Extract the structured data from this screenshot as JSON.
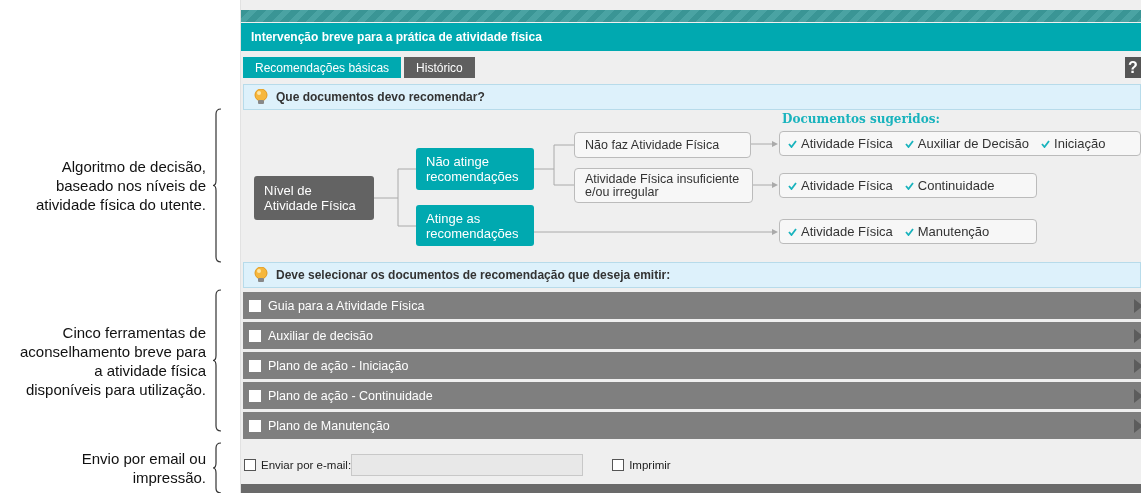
{
  "annotations": [
    {
      "text": "Algoritmo de decisão, baseado nos níveis de atividade física do utente."
    },
    {
      "text": "Cinco ferramentas de aconselhamento breve para a atividade física disponíveis para utilização."
    },
    {
      "text": "Envio por email ou impressão."
    }
  ],
  "header": {
    "title": "Intervenção breve para a prática de atividade física"
  },
  "tabs": [
    {
      "label": "Recomendações básicas",
      "selected": true
    },
    {
      "label": "Histórico",
      "selected": false
    }
  ],
  "help": {
    "label": "?"
  },
  "question_bar": {
    "text": "Que documentos devo recomendar?"
  },
  "diagram": {
    "root": "Nível de Atividade Física",
    "documents_heading": "Documentos sugeridos:",
    "branches": [
      {
        "label": "Não atinge recomendações",
        "children": [
          {
            "label": "Não faz Atividade Física",
            "documents": [
              "Atividade Física",
              "Auxiliar de Decisão",
              "Iniciação"
            ]
          },
          {
            "label": "Atividade Física insuficiente e/ou irregular",
            "documents": [
              "Atividade Física",
              "Continuidade"
            ]
          }
        ]
      },
      {
        "label": "Atinge as recomendações",
        "documents": [
          "Atividade Física",
          "Manutenção"
        ]
      }
    ]
  },
  "selection_bar": {
    "text": "Deve selecionar os documentos de recomendação que deseja emitir:"
  },
  "documents": [
    {
      "label": "Guia para a Atividade Física",
      "checked": false
    },
    {
      "label": "Auxiliar de decisão",
      "checked": false
    },
    {
      "label": "Plano de ação - Iniciação",
      "checked": false
    },
    {
      "label": "Plano de ação - Continuidade",
      "checked": false
    },
    {
      "label": "Plano de Manutenção",
      "checked": false
    }
  ],
  "footer": {
    "email_label": "Enviar por e-mail:",
    "email_checked": false,
    "print_label": "Imprimir",
    "print_checked": false
  }
}
